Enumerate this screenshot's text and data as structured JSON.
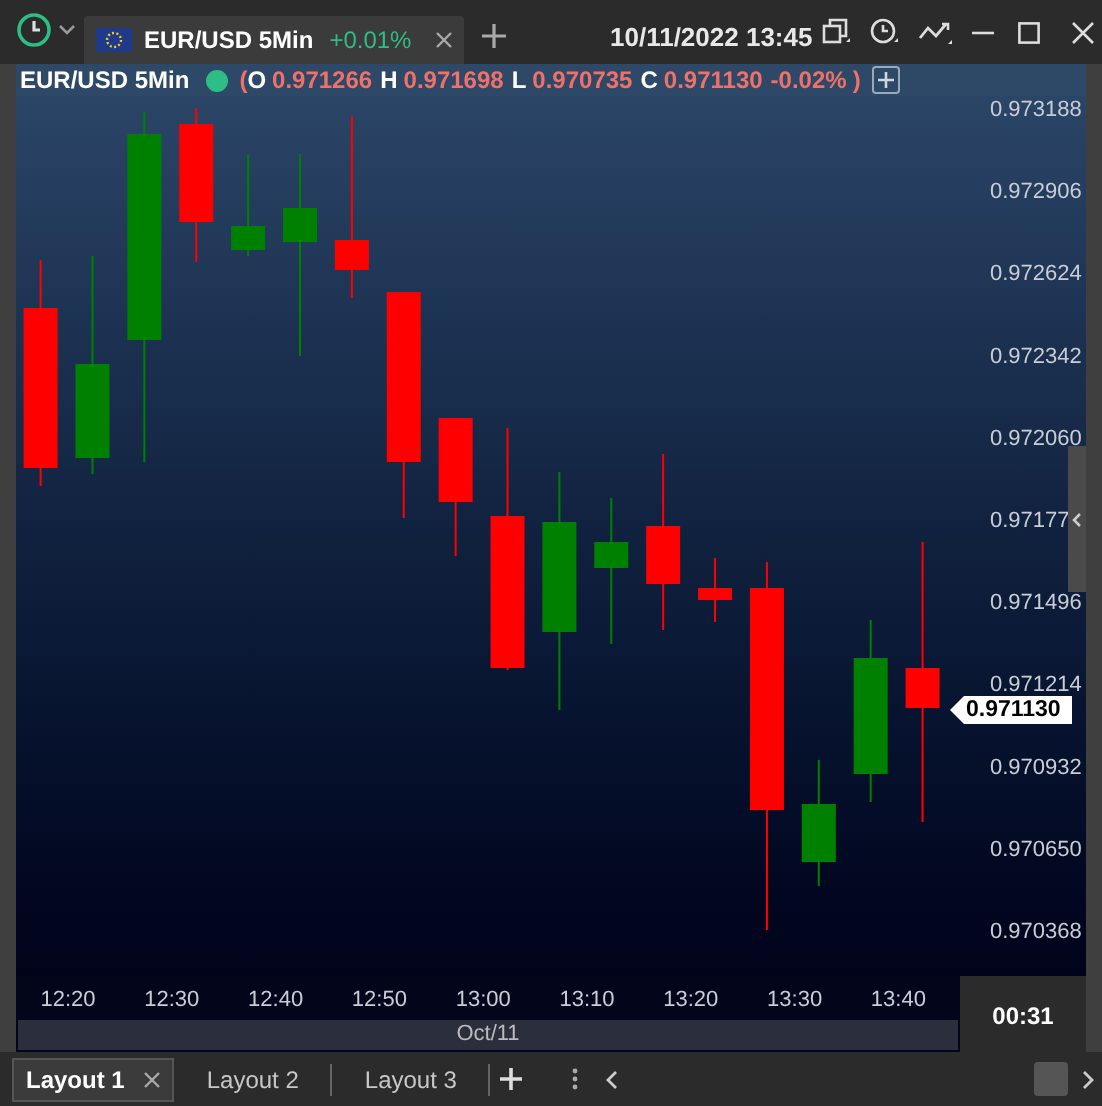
{
  "top_bar": {
    "tabs": [
      {
        "label": "EUR/USD 5Min",
        "change": "+0.01%",
        "selected": true
      }
    ],
    "datetime": "10/11/2022 13:45"
  },
  "legend": {
    "symbol": "EUR/USD 5Min",
    "open_paren": "(",
    "items": [
      {
        "label": "O",
        "value": "0.971266"
      },
      {
        "label": "H",
        "value": "0.971698"
      },
      {
        "label": "L",
        "value": "0.970735"
      },
      {
        "label": "C",
        "value": "0.971130"
      }
    ],
    "change": "-0.02%",
    "close_paren": ")"
  },
  "price_axis": [
    "0.973188",
    "0.972906",
    "0.972624",
    "0.972342",
    "0.972060",
    "0.97177",
    "0.971496",
    "0.971214",
    "0.970932",
    "0.970650",
    "0.970368"
  ],
  "current_price": "0.971130",
  "time_axis": [
    "12:20",
    "12:30",
    "12:40",
    "12:50",
    "13:00",
    "13:10",
    "13:20",
    "13:30",
    "13:40"
  ],
  "date_bar": "Oct/11",
  "countdown": "00:31",
  "layouts": [
    {
      "label": "Layout 1",
      "selected": true
    },
    {
      "label": "Layout 2",
      "selected": false
    },
    {
      "label": "Layout 3",
      "selected": false
    }
  ]
}
